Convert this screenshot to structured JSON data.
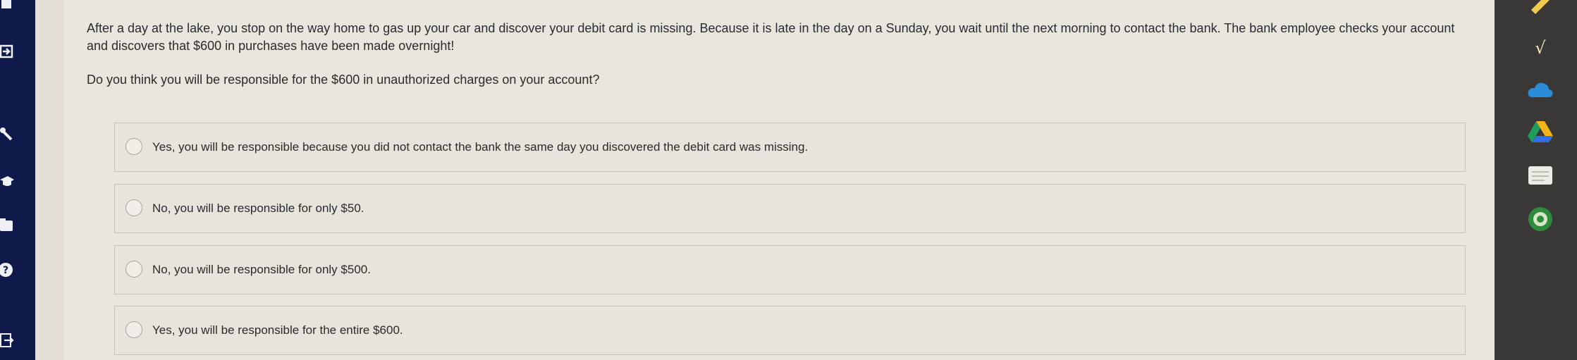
{
  "question": {
    "scenario": "After a day at the lake, you stop on the way home to gas up your car and discover your debit card is missing. Because it is late in the day on a Sunday, you wait until the next morning to contact the bank. The bank employee checks your account and discovers that $600 in purchases have been made overnight!",
    "prompt": "Do you think you will be responsible for the $600 in unauthorized charges on your account?"
  },
  "options": [
    {
      "label": "Yes, you will be responsible because you did not contact the bank the same day you discovered the debit card was missing."
    },
    {
      "label": "No, you will be responsible for only $50."
    },
    {
      "label": "No, you will be responsible for only $500."
    },
    {
      "label": "Yes, you will be responsible for the entire $600."
    }
  ],
  "left_rail_icons": [
    "book-icon",
    "login-icon",
    "key-icon",
    "graduation-cap-icon",
    "folder-icon",
    "help-icon",
    "logout-icon"
  ],
  "extension_icons": [
    "pencil-icon",
    "math-tool-icon",
    "cloud-icon",
    "google-drive-icon",
    "notes-icon",
    "circle-app-icon"
  ],
  "colors": {
    "left_rail": "#0f1a4a",
    "right_rail": "#3a3836",
    "page_background": "#e9e6e0"
  }
}
